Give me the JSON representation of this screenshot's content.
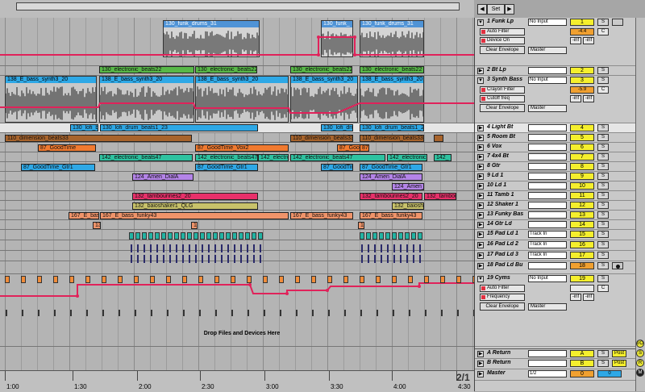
{
  "header": {
    "set_label": "Set",
    "left_arrow": "◀",
    "right_arrow": "▶"
  },
  "drop_hint": "Drop Files and Devices Here",
  "zoom_ratio": "2/1",
  "ruler_labels": [
    "1:00",
    "1:30",
    "2:00",
    "2:30",
    "3:00",
    "3:30",
    "4:00",
    "4:30"
  ],
  "colors": {
    "automation": "#e0225a",
    "vol_yellow": "#f5ef2d",
    "vol_orange": "#f0a030",
    "clip_blue": "#2ea8e6",
    "clip_green": "#58b848",
    "clip_brown": "#a8642c",
    "clip_orange": "#f07a30",
    "clip_teal": "#2ec2a0",
    "clip_purple": "#b484e8",
    "clip_pink": "#e8306a",
    "clip_khaki": "#c8c26a",
    "clip_salmon": "#f0946a"
  },
  "clips": {
    "funk_drums_1": "130_funk_drums_31",
    "funk_drums_2": "130_funk_",
    "funk_drums_3": "130_funk_drums_31",
    "elec_beats_a": "130_electronic_beats22",
    "elec_beats_b": "130_electronic_beats22",
    "elec_beats_c": "130_electronic_beats22",
    "elec_beats_d": "130_electronic_beats22",
    "bass_synth_a": "138_E_bass_synth3_20",
    "bass_synth_b": "138_E_bass_synth3_20",
    "bass_synth_c": "138_E_bass_synth3_20",
    "bass_synth_d": "138_E_bass_synth3_20",
    "bass_synth_e": "138_E_bass_synth3_20",
    "lofi_a": "130_lofi_bt",
    "lofi_b": "130_lofi_drum_beats1_23",
    "lofi_c": "130_lofi_dru",
    "lofi_d": "130_lofi_drum_beats1_23",
    "dimension_a": "110_dimension_beats33",
    "dimension_b": "110_dimension_beats33",
    "dimension_c": "110_dimension_beats33",
    "goodtime_vox_a": "87_GoodTime",
    "goodtime_vox_b": "87_GoodTime_Vox2",
    "goodtime_vox_c": "87_GoodTi",
    "goodtime_vox_d": "87_G",
    "elec47_a": "142_electronic_beats47",
    "elec47_b": "142_electronic_beats47",
    "elec47_c": "142_electro",
    "elec47_d": "142_electronic_beats47",
    "elec47_e": "142_",
    "gtr_a": "87_GoodTime_Gtr1",
    "gtr_b": "87_GoodTime_Gtr1",
    "gtr_c": "87_GoodTim",
    "gtr_d": "87_GoodTime_Gtr1",
    "amen_a": "124_Amen_DialA",
    "amen_b": "124_Amen_DialA",
    "amen_c": "124_Amen_",
    "tamb_a": "132_tambourines2_20",
    "tamb_b": "132_tambourines2_20",
    "tamb_c": "132_tambou",
    "shaker_a": "132_baioshaker1_QLG",
    "shaker_b": "132_baioshake",
    "funky_a": "167_E_bass",
    "funky_b": "167_E_bass_funky43",
    "funky_c": "167_E_bass_funky43",
    "funky_d": "167_E_bass_funky43",
    "gtrld_a": "13",
    "gtrld_b": "13",
    "gtrld_c": "13"
  },
  "tracks": {
    "t1": {
      "name": "1 Funk Lp",
      "input": "No Input",
      "vol": "1",
      "pan": "C",
      "solo": "S",
      "dev1": "Auto Filter",
      "dev2": "Device On",
      "clear": "Clear Envelope",
      "out": "Master",
      "vol2": "-4.4",
      "inf1": "-inf",
      "inf2": "-inf"
    },
    "t2": {
      "name": "2 Bt Lp",
      "vol": "2",
      "solo": "S"
    },
    "t3": {
      "name": "3 Synth Bass",
      "input": "No Input",
      "vol": "3",
      "solo": "S",
      "dev1": "Crayon Filter",
      "dev2": "Cutoff freq",
      "clear": "Clear Envelope",
      "out": "Master",
      "vol2": "-5.9",
      "pan": "C",
      "inf1": "-inf",
      "inf2": "-inf"
    },
    "t4": {
      "name": "4 Light Bt",
      "vol": "4",
      "solo": "S"
    },
    "t5": {
      "name": "5 Room Bt",
      "vol": "5",
      "solo": "S"
    },
    "t6": {
      "name": "6 Vox",
      "vol": "6",
      "solo": "S"
    },
    "t7": {
      "name": "7 4x4 Bt",
      "vol": "7",
      "solo": "S"
    },
    "t8": {
      "name": "8 Gtr",
      "vol": "8",
      "solo": "S"
    },
    "t9": {
      "name": "9 Ld 1",
      "vol": "9",
      "solo": "S"
    },
    "t10": {
      "name": "10 Ld 1",
      "vol": "10",
      "solo": "S"
    },
    "t11": {
      "name": "11 Tamb 1",
      "vol": "11",
      "solo": "S"
    },
    "t12": {
      "name": "12 Shaker 1",
      "vol": "12",
      "solo": "S"
    },
    "t13": {
      "name": "13 Funky Bas",
      "vol": "13",
      "solo": "S"
    },
    "t14": {
      "name": "14 Gtr Ld",
      "vol": "14",
      "solo": "S"
    },
    "t15": {
      "name": "15 Pad Ld 1",
      "input": "Track In",
      "vol": "15",
      "solo": "S"
    },
    "t16": {
      "name": "16 Pad Ld 2",
      "input": "Track In",
      "vol": "16",
      "solo": "S"
    },
    "t17": {
      "name": "17 Pad Ld 3",
      "input": "Track In",
      "vol": "17",
      "solo": "S"
    },
    "t18": {
      "name": "18 Pad Ld Bu",
      "vol": "18",
      "solo": "S"
    },
    "t19": {
      "name": "19 Cyms",
      "input": "No Input",
      "vol": "19",
      "solo": "S",
      "dev1": "Auto Filter",
      "dev2": "Frequency",
      "clear": "Clear Envelope",
      "out": "Master",
      "pan": "C",
      "inf1": "-inf",
      "inf2": "-inf"
    },
    "ra": {
      "name": "A Return",
      "vol": "A",
      "solo": "S",
      "post": "Post"
    },
    "rb": {
      "name": "B Return",
      "vol": "B",
      "solo": "S",
      "post": "Post"
    },
    "master": {
      "name": "Master",
      "input": "1/2",
      "vol": "0",
      "solo": "0"
    }
  }
}
